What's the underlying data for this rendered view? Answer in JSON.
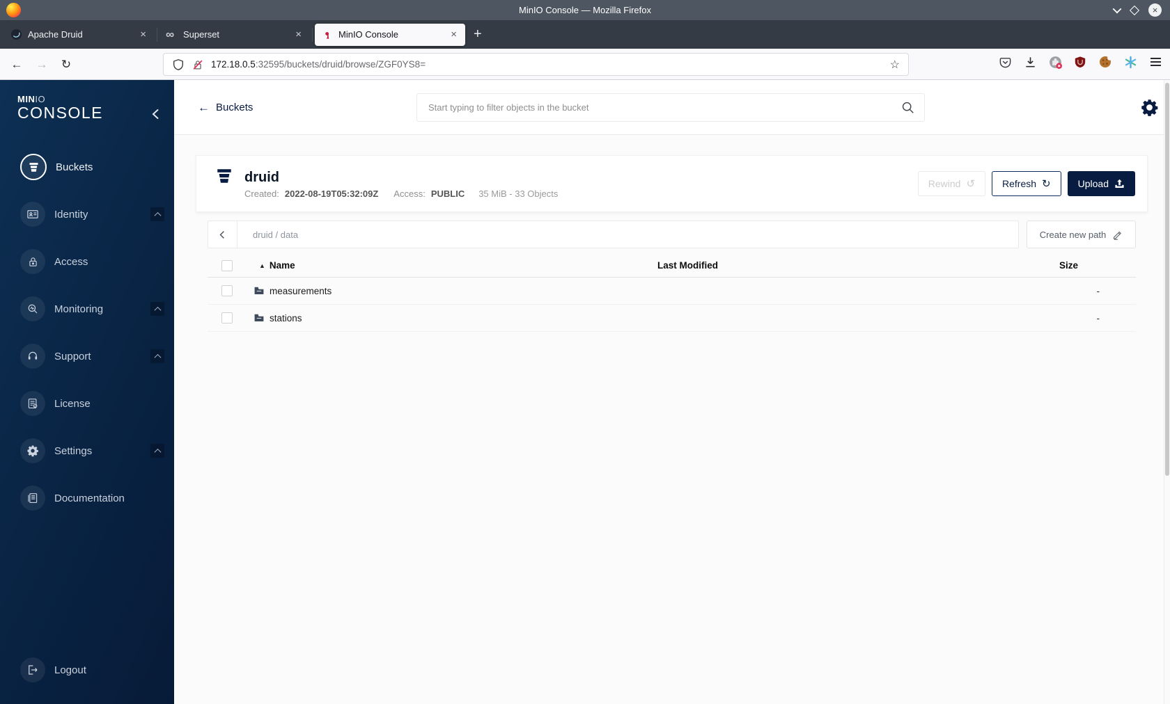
{
  "browser": {
    "window_title": "MinIO Console — Mozilla Firefox",
    "tabs": [
      {
        "label": "Apache Druid"
      },
      {
        "label": "Superset",
        "icon_glyph": "∞"
      },
      {
        "label": "MinIO Console"
      }
    ],
    "new_tab_glyph": "+",
    "close_glyph": "×",
    "nav": {
      "back": "←",
      "forward": "→",
      "reload": "↻"
    },
    "url_host": "172.18.0.5",
    "url_path": ":32595/buckets/druid/browse/ZGF0YS8=",
    "star_glyph": "☆"
  },
  "sidebar": {
    "logo": {
      "part1": "MIN",
      "part2": "IO",
      "part3": "CONSOLE"
    },
    "items": [
      {
        "label": "Buckets"
      },
      {
        "label": "Identity"
      },
      {
        "label": "Access"
      },
      {
        "label": "Monitoring"
      },
      {
        "label": "Support"
      },
      {
        "label": "License"
      },
      {
        "label": "Settings"
      },
      {
        "label": "Documentation"
      }
    ],
    "logout_label": "Logout"
  },
  "header": {
    "back_arrow": "←",
    "back_label": "Buckets",
    "search_placeholder": "Start typing to filter objects in the bucket"
  },
  "bucket": {
    "name": "druid",
    "created_label": "Created:",
    "created_value": "2022-08-19T05:32:09Z",
    "access_label": "Access:",
    "access_value": "PUBLIC",
    "stats": "35 MiB - 33 Objects",
    "buttons": {
      "rewind": "Rewind",
      "rewind_icon": "↺",
      "refresh": "Refresh",
      "refresh_icon": "↻",
      "upload": "Upload"
    }
  },
  "browse": {
    "path": "druid / data",
    "create_button": "Create new path",
    "table": {
      "sort_icon": "▲",
      "col_name": "Name",
      "col_modified": "Last Modified",
      "col_size": "Size",
      "rows": [
        {
          "name": "measurements",
          "size": "-"
        },
        {
          "name": "stations",
          "size": "-"
        }
      ]
    }
  }
}
